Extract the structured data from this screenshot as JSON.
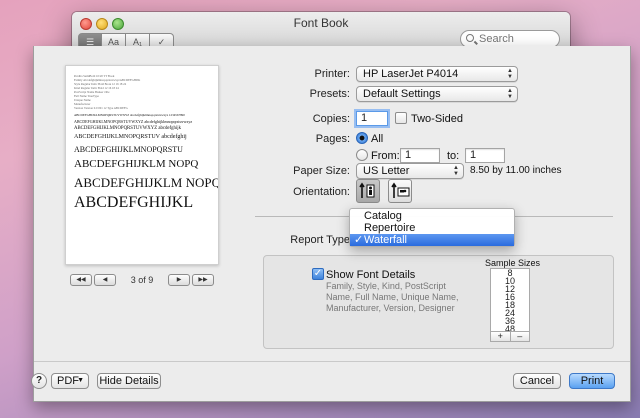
{
  "window": {
    "title": "Font Book",
    "search_placeholder": "Search",
    "toolbar_buttons": [
      "list-view",
      "sample-view",
      "info-view",
      "validate"
    ]
  },
  "preview": {
    "tiny_lines": [
      "Perdita SemiBold 10/20 TT Book",
      "Family   AbcdefghijklmnopqrstuvwxyzABCDEFGHIJK",
      "Style    Regular Italic Bold Book 12 16 18 24",
      "Kind     Regular Italic Bold 12 16 18 24",
      "PostScript Name   Basker ville",
      "Full Name   TrueType",
      "Unique Name",
      "Manufacturer",
      "Version   Version 0.0 001 12 Type ABCDEFG"
    ],
    "sample_lines": [
      "ABCDEFGHIJKLMNOPQRSTUVWXYZ abcdefghijklmnopqrstuvwxyz 1234567890",
      "ABCDEFGHIJKLMNOPQRSTUVWXYZ abcdefghijklmnopqrstuvwxyz",
      "ABCDEFGHIJKLMNOPQRSTUVWXYZ abcdefghijk",
      "ABCDEFGHIJKLMNOPQRSTUV abcdefghij",
      "ABCDEFGHIJKLMNOPQRSTU",
      "ABCDEFGHIJKLM NOPQ",
      "ABCDEFGHIJKLM NOPQ",
      "ABCDEFGHIJKL"
    ],
    "page_count_text": "3 of 9"
  },
  "print": {
    "printer_label": "Printer:",
    "printer_value": "HP LaserJet P4014",
    "presets_label": "Presets:",
    "presets_value": "Default Settings",
    "copies_label": "Copies:",
    "copies_value": "1",
    "two_sided_label": "Two-Sided",
    "pages_label": "Pages:",
    "pages_all_label": "All",
    "pages_from_label": "From:",
    "pages_from_value": "1",
    "pages_to_label": "to:",
    "pages_to_value": "1",
    "paper_size_label": "Paper Size:",
    "paper_size_value": "US Letter",
    "paper_dimensions": "8.50 by 11.00 inches",
    "orientation_label": "Orientation:",
    "report_type_label": "Report Type",
    "report_type_menu": [
      {
        "label": "Catalog",
        "selected": false,
        "checked": false
      },
      {
        "label": "Repertoire",
        "selected": false,
        "checked": false
      },
      {
        "label": "Waterfall",
        "selected": true,
        "checked": true
      }
    ],
    "show_font_details_label": "Show Font Details",
    "show_font_details_desc": "Family, Style, Kind, PostScript Name, Full Name, Unique Name, Manufacturer, Version, Designer",
    "sample_sizes_label": "Sample Sizes",
    "sample_sizes": [
      "8",
      "10",
      "12",
      "16",
      "18",
      "24",
      "36",
      "48"
    ],
    "plus_label": "+",
    "minus_label": "–"
  },
  "footer": {
    "help_label": "?",
    "pdf_label": "PDF",
    "hide_details_label": "Hide Details",
    "cancel_label": "Cancel",
    "print_label": "Print"
  },
  "colors": {
    "accent": "#3e83dc",
    "selection": "#2a6bde"
  }
}
